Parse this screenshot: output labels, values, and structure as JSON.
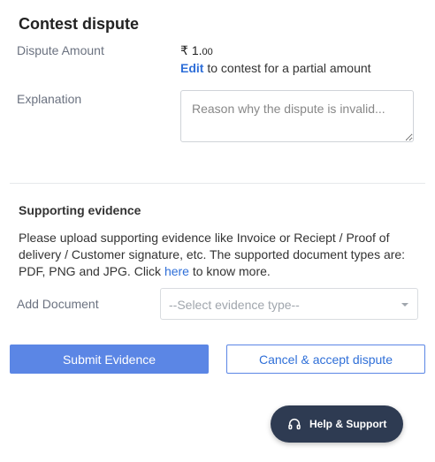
{
  "header": {
    "title": "Contest dispute"
  },
  "dispute_amount": {
    "label": "Dispute Amount",
    "currency": "₹",
    "value_main": "1.",
    "value_decimal": "00",
    "edit_link": "Edit",
    "edit_text": " to contest for a partial amount"
  },
  "explanation": {
    "label": "Explanation",
    "placeholder": "Reason why the dispute is invalid..."
  },
  "evidence": {
    "section_title": "Supporting evidence",
    "desc_prefix": "Please upload supporting evidence like Invoice or Reciept / Proof of delivery / Customer signature, etc. The supported document types are: PDF, PNG and JPG. Click ",
    "desc_link": "here",
    "desc_suffix": " to know more.",
    "add_document_label": "Add Document",
    "select_placeholder": "--Select evidence type--"
  },
  "actions": {
    "submit_label": "Submit Evidence",
    "cancel_label": "Cancel & accept dispute"
  },
  "help": {
    "label": "Help & Support",
    "icon": "headset-icon"
  },
  "colors": {
    "accent": "#2f6fd8",
    "primary_button": "#5b86e5",
    "help_bg": "#2e3b52"
  }
}
